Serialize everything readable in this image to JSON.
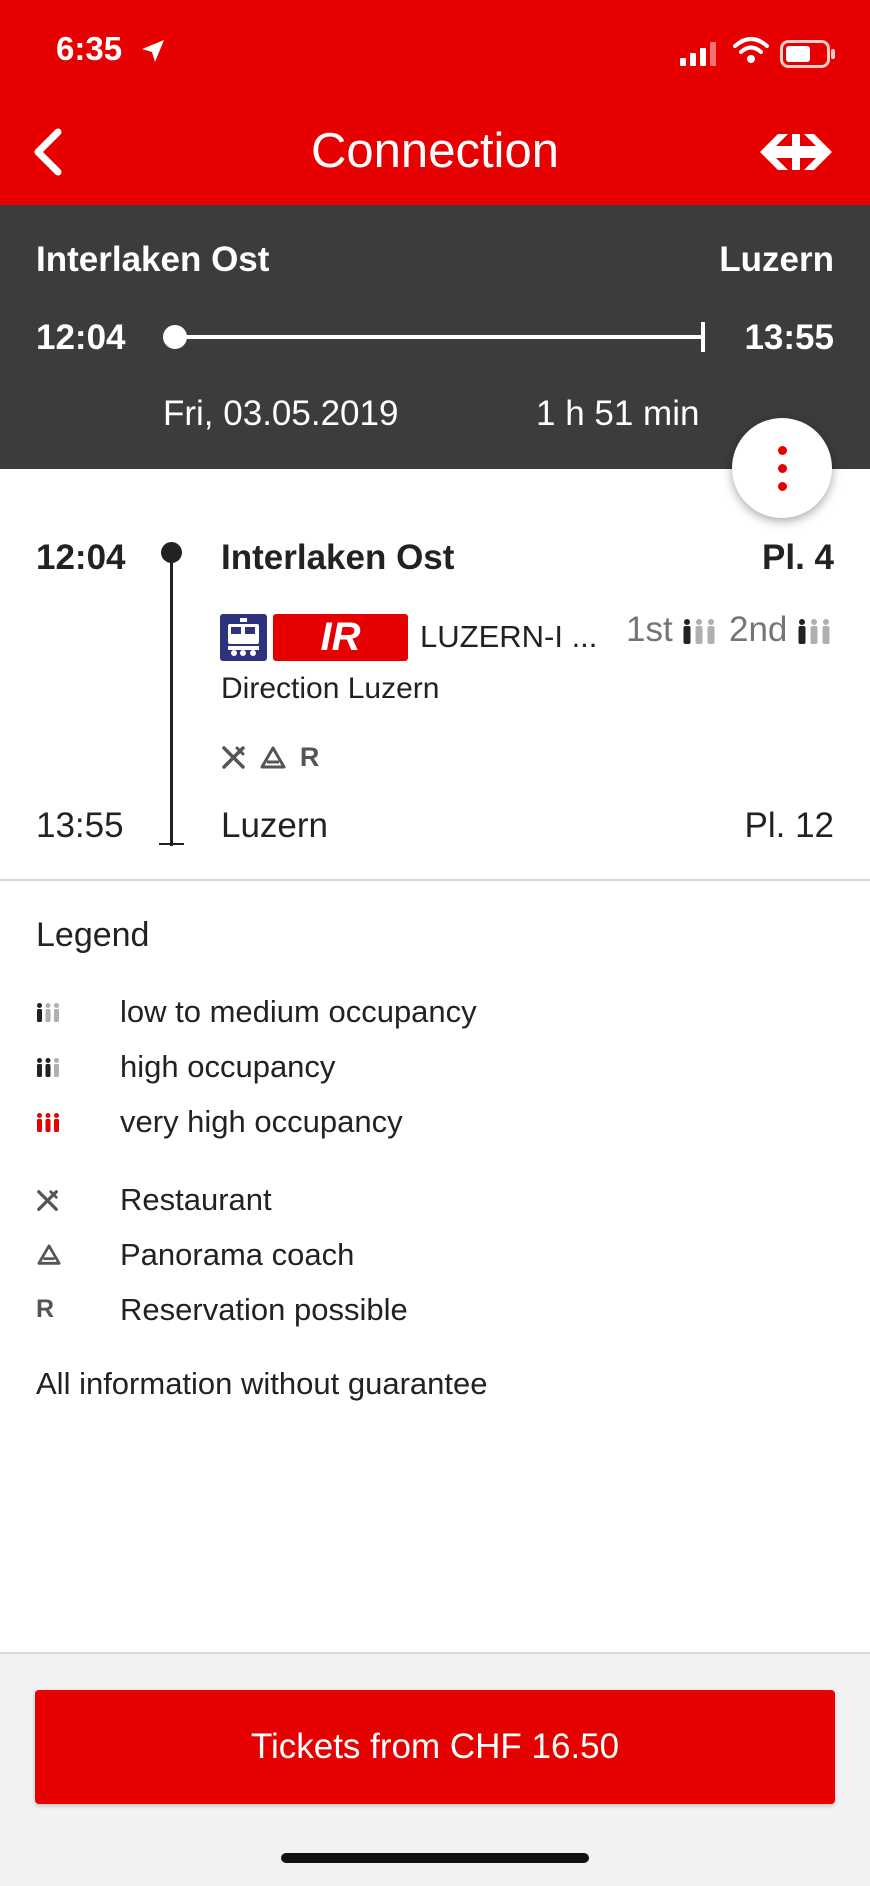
{
  "status_bar": {
    "time": "6:35"
  },
  "nav": {
    "title": "Connection"
  },
  "summary": {
    "from": "Interlaken Ost",
    "to": "Luzern",
    "departure": "12:04",
    "arrival": "13:55",
    "date": "Fri, 03.05.2019",
    "duration": "1 h 51 min"
  },
  "journey": {
    "start": {
      "time": "12:04",
      "station": "Interlaken Ost",
      "platform": "Pl. 4"
    },
    "end": {
      "time": "13:55",
      "station": "Luzern",
      "platform": "Pl. 12"
    },
    "train": {
      "product": "IR",
      "destination": "LUZERN-I ...",
      "direction": "Direction Luzern",
      "occupancy_first_label": "1st",
      "occupancy_second_label": "2nd",
      "attributes": [
        "restaurant-icon",
        "panorama-icon",
        "R"
      ]
    }
  },
  "legend": {
    "title": "Legend",
    "occupancy": [
      {
        "label": "low to medium occupancy",
        "level": 1
      },
      {
        "label": "high occupancy",
        "level": 2
      },
      {
        "label": "very high occupancy",
        "level": 3
      }
    ],
    "attributes": [
      {
        "icon": "restaurant-icon",
        "label": "Restaurant"
      },
      {
        "icon": "panorama-icon",
        "label": "Panorama coach"
      },
      {
        "symbol": "R",
        "label": "Reservation possible"
      }
    ],
    "disclaimer": "All information without guarantee"
  },
  "footer": {
    "ticket_button": "Tickets from CHF 16.50"
  },
  "colors": {
    "brand_red": "#e60000",
    "header_dark": "#3c3c3c",
    "occupancy_grey": "#b0b0b0",
    "occupancy_dark": "#222222"
  }
}
